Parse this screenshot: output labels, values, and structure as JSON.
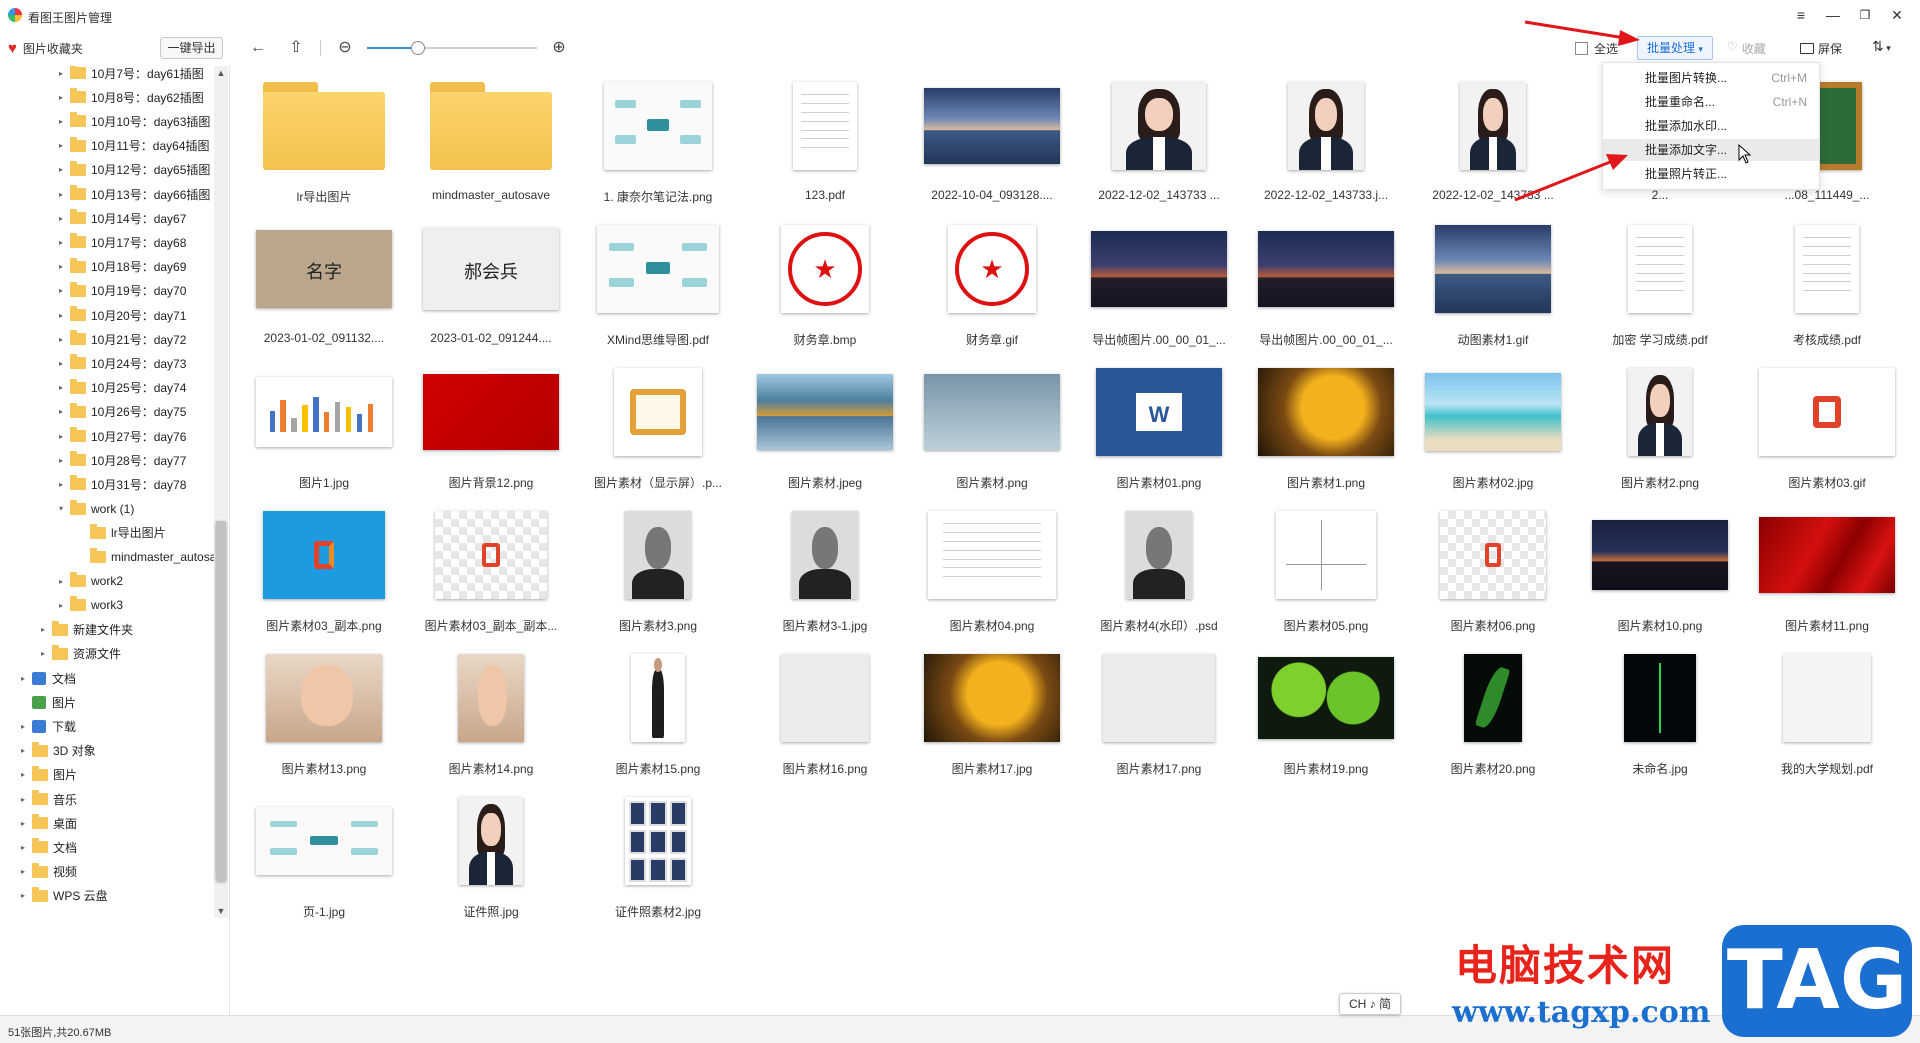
{
  "app": {
    "title": "看图王图片管理",
    "window_controls": [
      "≡",
      "—",
      "❐",
      "✕"
    ]
  },
  "toolbar": {
    "favorites_label": "图片收藏夹",
    "export_label": "一键导出",
    "select_all_label": "全选",
    "batch_label": "批量处理",
    "favorite_label": "收藏",
    "screen_label": "屏保",
    "zoom_level": 0.3
  },
  "batch_menu": [
    {
      "label": "批量图片转换...",
      "shortcut": "Ctrl+M"
    },
    {
      "label": "批量重命名...",
      "shortcut": "Ctrl+N"
    },
    {
      "label": "批量添加水印...",
      "shortcut": ""
    },
    {
      "label": "批量添加文字...",
      "shortcut": "",
      "hover": true
    },
    {
      "label": "批量照片转正...",
      "shortcut": ""
    }
  ],
  "sidebar": {
    "tree": [
      {
        "label": "10月7号：day61插图",
        "depth": 3,
        "type": "folder",
        "caret": "▸"
      },
      {
        "label": "10月8号：day62插图",
        "depth": 3,
        "type": "folder",
        "caret": "▸"
      },
      {
        "label": "10月10号：day63插图",
        "depth": 3,
        "type": "folder",
        "caret": "▸"
      },
      {
        "label": "10月11号：day64插图",
        "depth": 3,
        "type": "folder",
        "caret": "▸"
      },
      {
        "label": "10月12号：day65插图",
        "depth": 3,
        "type": "folder",
        "caret": "▸"
      },
      {
        "label": "10月13号：day66插图",
        "depth": 3,
        "type": "folder",
        "caret": "▸"
      },
      {
        "label": "10月14号：day67",
        "depth": 3,
        "type": "folder",
        "caret": "▸"
      },
      {
        "label": "10月17号：day68",
        "depth": 3,
        "type": "folder",
        "caret": "▸"
      },
      {
        "label": "10月18号：day69",
        "depth": 3,
        "type": "folder",
        "caret": "▸"
      },
      {
        "label": "10月19号：day70",
        "depth": 3,
        "type": "folder",
        "caret": "▸"
      },
      {
        "label": "10月20号：day71",
        "depth": 3,
        "type": "folder",
        "caret": "▸"
      },
      {
        "label": "10月21号：day72",
        "depth": 3,
        "type": "folder",
        "caret": "▸"
      },
      {
        "label": "10月24号：day73",
        "depth": 3,
        "type": "folder",
        "caret": "▸"
      },
      {
        "label": "10月25号：day74",
        "depth": 3,
        "type": "folder",
        "caret": "▸"
      },
      {
        "label": "10月26号：day75",
        "depth": 3,
        "type": "folder",
        "caret": "▸"
      },
      {
        "label": "10月27号：day76",
        "depth": 3,
        "type": "folder",
        "caret": "▸"
      },
      {
        "label": "10月28号：day77",
        "depth": 3,
        "type": "folder",
        "caret": "▸"
      },
      {
        "label": "10月31号：day78",
        "depth": 3,
        "type": "folder",
        "caret": "▸"
      },
      {
        "label": "work (1)",
        "depth": 3,
        "type": "folder",
        "caret": "▾"
      },
      {
        "label": "lr导出图片",
        "depth": 4,
        "type": "folder",
        "caret": ""
      },
      {
        "label": "mindmaster_autosave",
        "depth": 4,
        "type": "folder",
        "caret": ""
      },
      {
        "label": "work2",
        "depth": 3,
        "type": "folder",
        "caret": "▸"
      },
      {
        "label": "work3",
        "depth": 3,
        "type": "folder",
        "caret": "▸"
      },
      {
        "label": "新建文件夹",
        "depth": 2,
        "type": "folder",
        "caret": "▸"
      },
      {
        "label": "资源文件",
        "depth": 2,
        "type": "folder",
        "caret": "▸"
      },
      {
        "label": "文档",
        "depth": 1,
        "type": "doc",
        "caret": "▸"
      },
      {
        "label": "图片",
        "depth": 1,
        "type": "pic",
        "caret": ""
      },
      {
        "label": "下载",
        "depth": 1,
        "type": "download",
        "caret": "▸"
      },
      {
        "label": "3D 对象",
        "depth": 1,
        "type": "folder",
        "caret": "▸"
      },
      {
        "label": "图片",
        "depth": 1,
        "type": "folder",
        "caret": "▸"
      },
      {
        "label": "音乐",
        "depth": 1,
        "type": "folder",
        "caret": "▸"
      },
      {
        "label": "桌面",
        "depth": 1,
        "type": "folder",
        "caret": "▸"
      },
      {
        "label": "文档",
        "depth": 1,
        "type": "folder",
        "caret": "▸"
      },
      {
        "label": "视频",
        "depth": 1,
        "type": "folder",
        "caret": "▸"
      },
      {
        "label": "WPS 云盘",
        "depth": 1,
        "type": "folder",
        "caret": "▸"
      }
    ]
  },
  "grid": {
    "items": [
      {
        "name": "lr导出图片",
        "kind": "t-folder",
        "w": 122,
        "h": 88
      },
      {
        "name": "mindmaster_autosave",
        "kind": "t-folder",
        "w": 122,
        "h": 88
      },
      {
        "name": "1. 康奈尔笔记法.png",
        "kind": "t-mind",
        "w": 108,
        "h": 88
      },
      {
        "name": "123.pdf",
        "kind": "t-doc",
        "w": 64,
        "h": 88
      },
      {
        "name": "2022-10-04_093128....",
        "kind": "t-sky",
        "w": 136,
        "h": 76
      },
      {
        "name": "2022-12-02_143733 ...",
        "kind": "t-person",
        "w": 94,
        "h": 88
      },
      {
        "name": "2022-12-02_143733.j...",
        "kind": "t-person",
        "w": 76,
        "h": 88
      },
      {
        "name": "2022-12-02_143733 ...",
        "kind": "t-person",
        "w": 66,
        "h": 88
      },
      {
        "name": "2...",
        "kind": "t-autumn",
        "w": 70,
        "h": 88
      },
      {
        "name": "...08_111449_...",
        "kind": "t-chalk",
        "w": 70,
        "h": 88
      },
      {
        "name": "2023-01-02_091132....",
        "kind": "t-kraft",
        "w": 136,
        "h": 78,
        "text": "名字"
      },
      {
        "name": "2023-01-02_091244....",
        "kind": "t-sign",
        "w": 136,
        "h": 82,
        "text": "郝会兵"
      },
      {
        "name": "XMind思维导图.pdf",
        "kind": "t-mind",
        "w": 122,
        "h": 88
      },
      {
        "name": "财务章.bmp",
        "kind": "t-seal",
        "w": 88,
        "h": 88
      },
      {
        "name": "财务章.gif",
        "kind": "t-seal",
        "w": 88,
        "h": 88
      },
      {
        "name": "导出帧图片.00_00_01_...",
        "kind": "t-city",
        "w": 136,
        "h": 76
      },
      {
        "name": "导出帧图片.00_00_01_...",
        "kind": "t-city",
        "w": 136,
        "h": 76
      },
      {
        "name": "动图素材1.gif",
        "kind": "t-sky",
        "w": 116,
        "h": 88
      },
      {
        "name": "加密 学习成绩.pdf",
        "kind": "t-doc",
        "w": 64,
        "h": 88
      },
      {
        "name": "考核成绩.pdf",
        "kind": "t-doc",
        "w": 64,
        "h": 88
      },
      {
        "name": "图片1.jpg",
        "kind": "t-bar",
        "w": 136,
        "h": 70
      },
      {
        "name": "图片背景12.png",
        "kind": "t-red",
        "w": 136,
        "h": 76
      },
      {
        "name": "图片素材（显示屏）.p...",
        "kind": "t-frame",
        "w": 88,
        "h": 88
      },
      {
        "name": "图片素材.jpeg",
        "kind": "t-lake",
        "w": 136,
        "h": 76
      },
      {
        "name": "图片素材.png",
        "kind": "t-lab",
        "w": 136,
        "h": 76
      },
      {
        "name": "图片素材01.png",
        "kind": "t-word",
        "w": 126,
        "h": 88
      },
      {
        "name": "图片素材1.png",
        "kind": "t-leaf",
        "w": 136,
        "h": 88
      },
      {
        "name": "图片素材02.jpg",
        "kind": "t-beach",
        "w": 136,
        "h": 78
      },
      {
        "name": "图片素材2.png",
        "kind": "t-person",
        "w": 64,
        "h": 88
      },
      {
        "name": "图片素材03.gif",
        "kind": "t-office",
        "w": 136,
        "h": 88
      },
      {
        "name": "图片素材03_副本.png",
        "kind": "t-office2",
        "w": 122,
        "h": 88
      },
      {
        "name": "图片素材03_副本_副本...",
        "kind": "t-check",
        "w": 112,
        "h": 88
      },
      {
        "name": "图片素材3.png",
        "kind": "t-old",
        "w": 66,
        "h": 88
      },
      {
        "name": "图片素材3-1.jpg",
        "kind": "t-old",
        "w": 66,
        "h": 88
      },
      {
        "name": "图片素材04.png",
        "kind": "t-doc",
        "w": 128,
        "h": 88
      },
      {
        "name": "图片素材4(水印）.psd",
        "kind": "t-old",
        "w": 66,
        "h": 88
      },
      {
        "name": "图片素材05.png",
        "kind": "t-graph",
        "w": 100,
        "h": 88
      },
      {
        "name": "图片素材06.png",
        "kind": "t-check",
        "w": 106,
        "h": 88
      },
      {
        "name": "图片素材10.png",
        "kind": "t-city2",
        "w": 136,
        "h": 70
      },
      {
        "name": "图片素材11.png",
        "kind": "t-silk",
        "w": 136,
        "h": 76
      },
      {
        "name": "图片素材13.png",
        "kind": "t-skin",
        "w": 116,
        "h": 88
      },
      {
        "name": "图片素材14.png",
        "kind": "t-skin",
        "w": 66,
        "h": 88
      },
      {
        "name": "图片素材15.png",
        "kind": "t-man",
        "w": 54,
        "h": 88
      },
      {
        "name": "图片素材16.png",
        "kind": "t-note",
        "w": 88,
        "h": 88
      },
      {
        "name": "图片素材17.jpg",
        "kind": "t-leaf",
        "w": 136,
        "h": 88
      },
      {
        "name": "图片素材17.png",
        "kind": "t-note",
        "w": 112,
        "h": 88
      },
      {
        "name": "图片素材19.png",
        "kind": "t-green",
        "w": 136,
        "h": 82
      },
      {
        "name": "图片素材20.png",
        "kind": "t-dark",
        "w": 58,
        "h": 88
      },
      {
        "name": "未命名.jpg",
        "kind": "t-mark",
        "w": 72,
        "h": 88
      },
      {
        "name": "我的大学规划.pdf",
        "kind": "t-card",
        "w": 88,
        "h": 88
      },
      {
        "name": "页-1.jpg",
        "kind": "t-mind",
        "w": 136,
        "h": 68
      },
      {
        "name": "证件照.jpg",
        "kind": "t-person",
        "w": 64,
        "h": 88
      },
      {
        "name": "证件照素材2.jpg",
        "kind": "t-photos",
        "w": 66,
        "h": 88
      }
    ]
  },
  "status": {
    "summary": "51张图片,共20.67MB",
    "ime": "CH ♪ 简"
  },
  "watermark": {
    "title": "电脑技术网",
    "url": "www.tagxp.com",
    "tag": "TAG"
  }
}
